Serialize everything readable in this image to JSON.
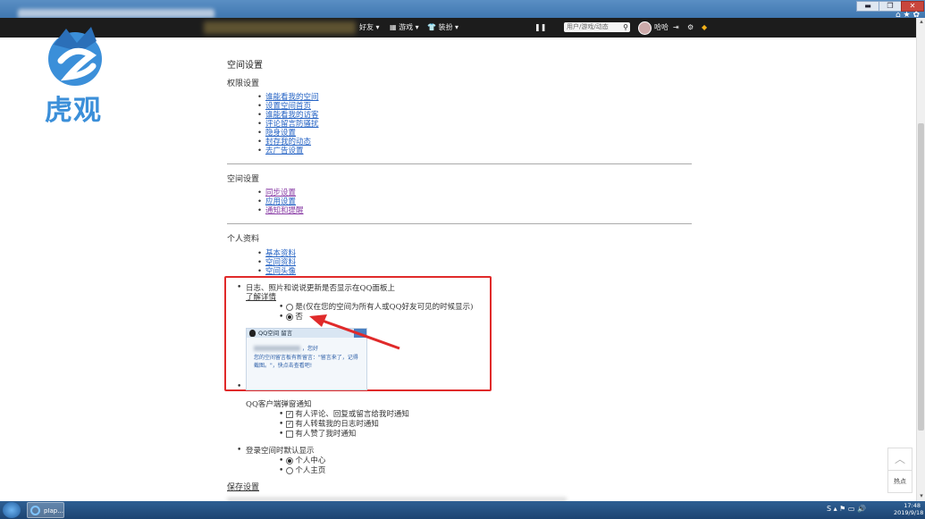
{
  "browser": {
    "window_controls": {
      "minimize": "▬",
      "maximize": "❐",
      "close": "✕"
    },
    "toolbar_icons": "⌂ ★ ✿"
  },
  "navbar": {
    "items": [
      {
        "label": "好友 ▾"
      },
      {
        "label": "游戏 ▾"
      },
      {
        "label": "装扮 ▾"
      }
    ],
    "pause_icon": "❚❚",
    "search_placeholder": "用户/游戏/动态",
    "username": "哈哈",
    "icons": [
      "exit-icon",
      "gear-icon",
      "diamond-icon"
    ]
  },
  "logo": {
    "text": "虎观",
    "color": "#3b8fd9"
  },
  "page": {
    "title": "空间设置",
    "permissions": {
      "heading": "权限设置",
      "links": [
        "谁能看我的空间",
        "设置空间首页",
        "谁能看我的访客",
        "评论留言防骚扰",
        "隐身设置",
        "封存我的动态",
        "去广告设置"
      ]
    },
    "space": {
      "heading": "空间设置",
      "links": [
        "同步设置",
        "应用设置",
        "通知和提醒"
      ]
    },
    "profile": {
      "heading": "个人资料",
      "links": [
        "基本资料",
        "空间资料",
        "空间头像"
      ]
    },
    "panel_setting": {
      "question": "日志、照片和说说更新是否显示在QQ面板上",
      "detail_link": "了解详情",
      "option_yes": "是(仅在您的空间为所有人或QQ好友可见的时候显示)",
      "option_no": "否",
      "selected": "否"
    },
    "preview": {
      "title": "QQ空间 留言",
      "greeting": "，您好",
      "message": "您的空间留言板有新留言：\"留言来了，记得截图。\"，快点击查看吧!"
    },
    "client_notify": {
      "heading": "QQ客户端弹窗通知",
      "options": [
        {
          "label": "有人评论、回复或留言给我时通知",
          "checked": true
        },
        {
          "label": "有人转载我的日志时通知",
          "checked": true
        },
        {
          "label": "有人赞了我时通知",
          "checked": false
        }
      ]
    },
    "login_default": {
      "heading": "登录空间时默认显示",
      "options": [
        {
          "label": "个人中心",
          "selected": true
        },
        {
          "label": "个人主页",
          "selected": false
        }
      ]
    },
    "save_link": "保存设置"
  },
  "float_panel": {
    "top_icon": "︿",
    "hot_label": "热点"
  },
  "taskbar": {
    "ie_label": "pIap...",
    "tray": "S  ▴ ⚑ ▭ 🔊",
    "time": "17:48",
    "date": "2019/9/18"
  },
  "colors": {
    "link": "#2563c4",
    "visited": "#8a3ea6",
    "highlight": "#e02a2a",
    "arrow": "#e02a2a"
  }
}
